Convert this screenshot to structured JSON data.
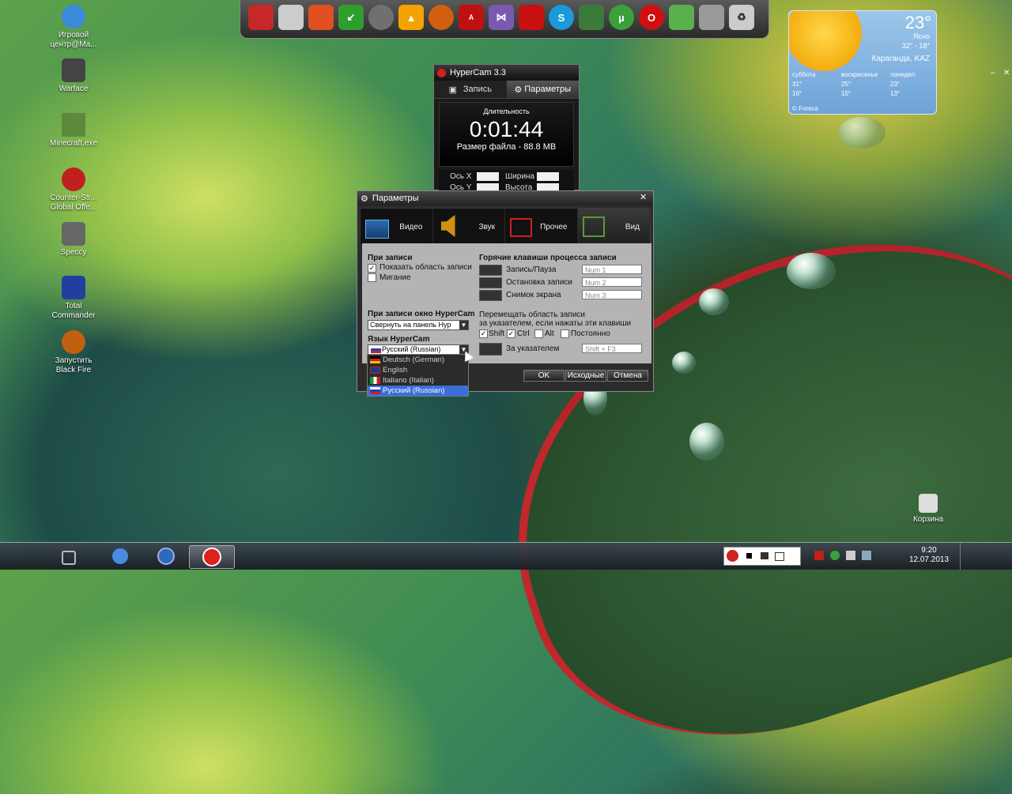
{
  "desktop": {
    "icons": [
      {
        "label": "Игровой центр@Ma...",
        "color": "#3a8ad8"
      },
      {
        "label": "Warface",
        "color": "#444444"
      },
      {
        "label": "Minecraft.exe",
        "color": "#5d8a3a"
      },
      {
        "label": "Counter-Str... Global Offe...",
        "color": "#c02020"
      },
      {
        "label": "Speccy",
        "color": "#666666"
      },
      {
        "label": "Total Commander",
        "color": "#2040a0"
      },
      {
        "label": "Запустить Black Fire",
        "color": "#c06010"
      }
    ],
    "trash_label": "Корзина"
  },
  "dock": {
    "items": [
      {
        "icon": "monitor-icon",
        "color": "#c62828"
      },
      {
        "icon": "network-icon",
        "color": "#cccccc"
      },
      {
        "icon": "ccleaner-icon",
        "color": "#e05020"
      },
      {
        "icon": "download-arrow-icon",
        "color": "#2e9e2e"
      },
      {
        "icon": "steam-icon",
        "color": "#707070"
      },
      {
        "icon": "aimp-icon",
        "color": "#f5a300"
      },
      {
        "icon": "orb-icon",
        "color": "#d06010"
      },
      {
        "icon": "alcohol-120-icon",
        "color": "#c01010"
      },
      {
        "icon": "visual-studio-icon",
        "color": "#7a5ab0"
      },
      {
        "icon": "acrobat-icon",
        "color": "#c81010"
      },
      {
        "icon": "skype-icon",
        "color": "#1a9ad8"
      },
      {
        "icon": "mortar-icon",
        "color": "#3a7a3a"
      },
      {
        "icon": "utorrent-icon",
        "color": "#3aa03a"
      },
      {
        "icon": "opera-icon",
        "color": "#d01010"
      },
      {
        "icon": "green-gem-icon",
        "color": "#5ab04a"
      },
      {
        "icon": "bird-icon",
        "color": "#999999"
      },
      {
        "icon": "recycle-icon",
        "color": "#cccccc"
      }
    ]
  },
  "weather": {
    "temp": "23°",
    "condition": "Ясно",
    "range": "32° - 18°",
    "city": "Караганда, KAZ",
    "days": [
      {
        "name": "суббота",
        "hi": "31°",
        "lo": "16°"
      },
      {
        "name": "воскресенье",
        "hi": "25°",
        "lo": "15°"
      },
      {
        "name": "понедел.",
        "hi": "23°",
        "lo": "13°"
      }
    ],
    "brand": "© Foreca"
  },
  "hypercam": {
    "title": "HyperCam 3.3",
    "tab_record": "Запись",
    "tab_params": "Параметры",
    "duration_label": "Длительность",
    "time": "0:01:44",
    "filesize": "Размер файла - 88.8 MB",
    "axis_x": "Ось X",
    "axis_y": "Ось Y",
    "width": "Ширина",
    "height": "Высота"
  },
  "params": {
    "title": "Параметры",
    "tabs": [
      {
        "label": "Видео",
        "icon": "filmstrip-icon"
      },
      {
        "label": "Звук",
        "icon": "speaker-icon"
      },
      {
        "label": "Прочее",
        "icon": "windows-icon"
      },
      {
        "label": "Вид",
        "icon": "screen-layout-icon"
      }
    ],
    "when_recording": "При записи",
    "show_area": "Показать область записи",
    "blink": "Мигание",
    "when_recording_window": "При записи окно HyperCam",
    "window_mode": "Свернуть на панель Hyp",
    "lang_label": "Язык HyperCam",
    "lang_value": "Русский (Russian)",
    "lang_options": [
      {
        "label": "Deutsch (German)",
        "flag": "de"
      },
      {
        "label": "English",
        "flag": "gb"
      },
      {
        "label": "Italiano (Italian)",
        "flag": "it"
      },
      {
        "label": "Русский (Russian)",
        "flag": "ru"
      }
    ],
    "hotkeys_title": "Горячие клавиши процесса записи",
    "hotkeys": [
      {
        "label": "Запись/Пауза",
        "value": "Num 1"
      },
      {
        "label": "Остановка записи",
        "value": "Num 2"
      },
      {
        "label": "Снимок экрана",
        "value": "Num 3"
      }
    ],
    "move_text_1": "Перемещать область записи",
    "move_text_2": "за указателем, если нажаты эти клавиши",
    "mods": {
      "shift": "Shift",
      "ctrl": "Ctrl",
      "alt": "Alt",
      "always": "Постоянно"
    },
    "follow_label": "За указателем",
    "follow_value": "Shift + F3",
    "ok": "OK",
    "defaults": "Исходные",
    "cancel": "Отмена"
  },
  "taskbar": {
    "time": "9:20",
    "date": "12.07.2013"
  }
}
